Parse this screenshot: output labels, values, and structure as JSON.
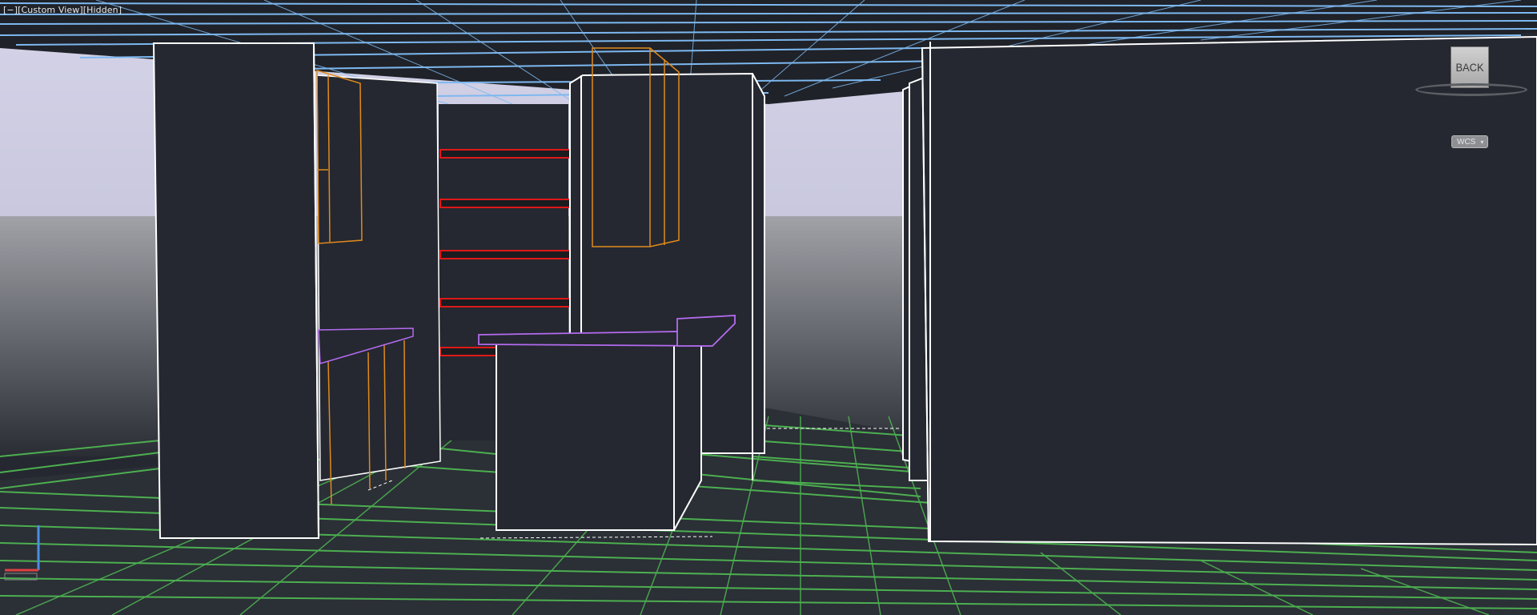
{
  "viewport": {
    "label": "[−][Custom View][Hidden]"
  },
  "viewcube": {
    "face_label": "BACK",
    "ucs_menu_label": "WCS",
    "ucs_menu_arrow": "chevron-down-icon"
  },
  "colors": {
    "background": "#252830",
    "sky": "#cccbe0",
    "ceiling_grid": "#7db8f0",
    "floor_grid": "#4caf50",
    "cabinet_edges": "#e08a1e",
    "countertop_edges": "#b46bf0",
    "shelf_highlight": "#e01818",
    "wall_edges": "#ffffff",
    "ucs_x_axis": "#e04040",
    "ucs_y_axis": "#4a90e2"
  }
}
